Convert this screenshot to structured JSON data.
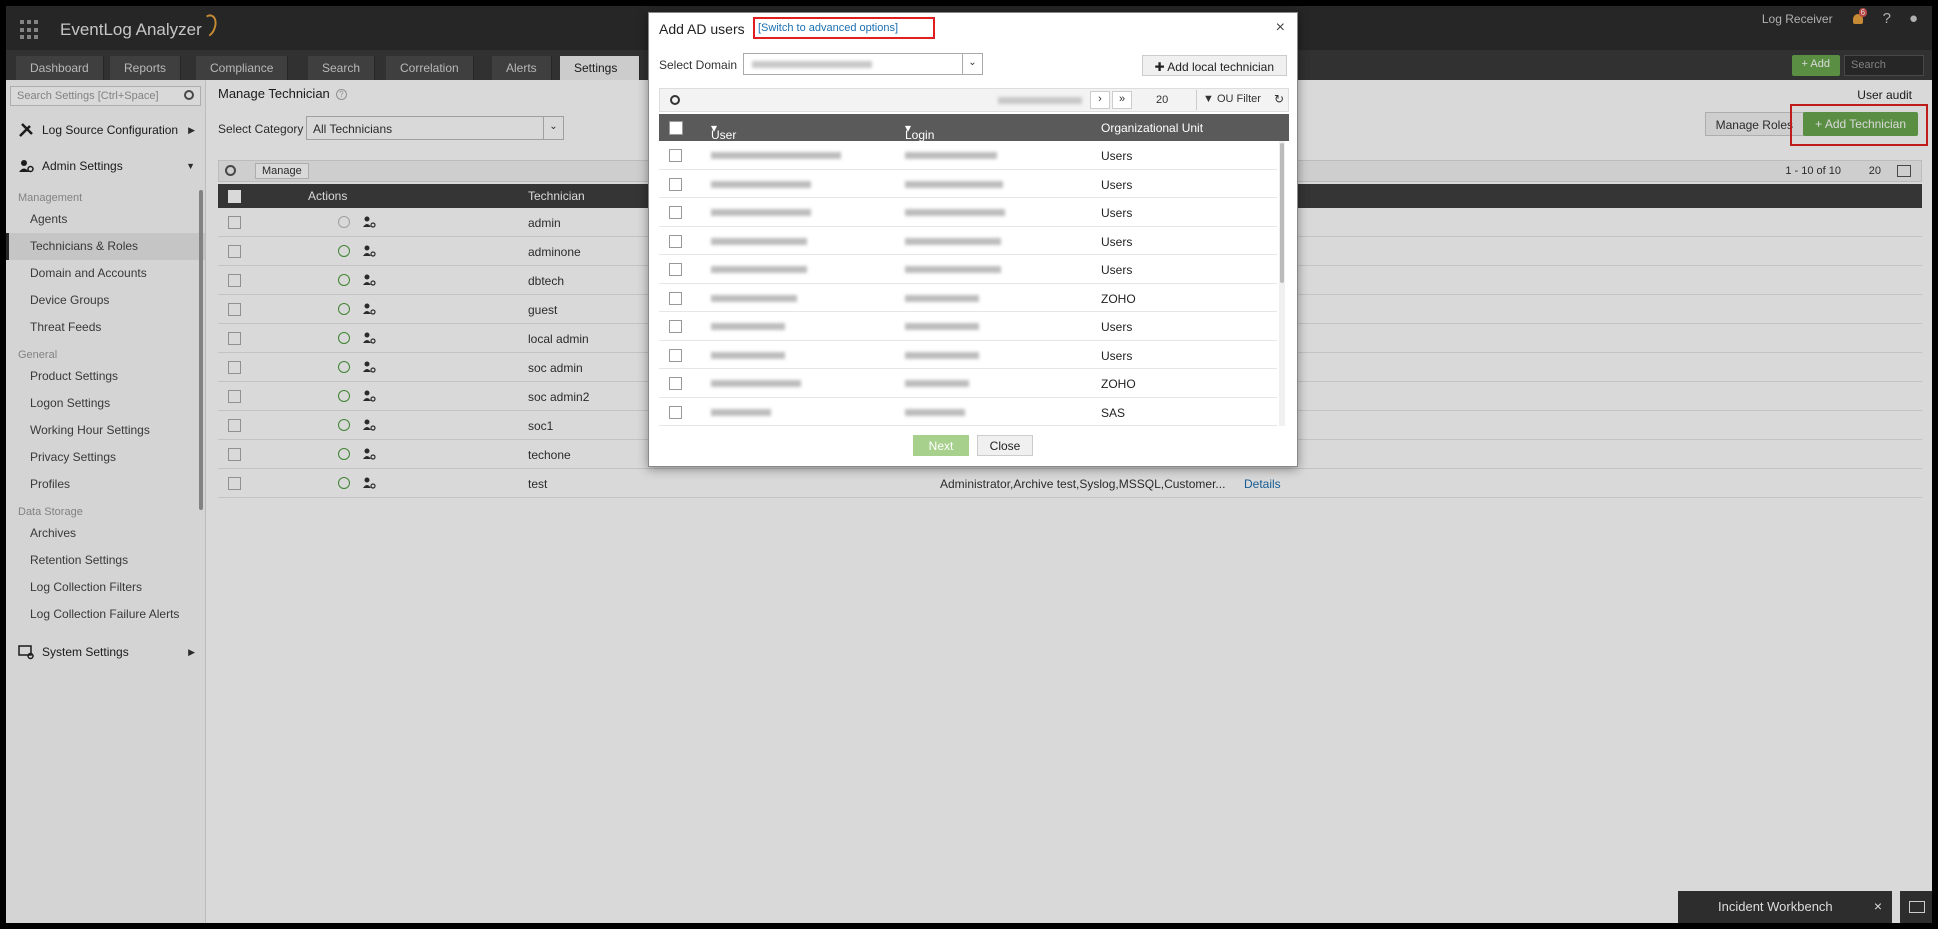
{
  "app": {
    "title": "EventLog Analyzer"
  },
  "header": {
    "log_receiver": "Log Receiver",
    "notif_count": "6",
    "help": "?",
    "user_icon": "user-circle-icon"
  },
  "nav": {
    "tabs": [
      "Dashboard",
      "Reports",
      "Compliance",
      "Search",
      "Correlation",
      "Alerts",
      "Settings"
    ],
    "active_tab": "Settings",
    "add_label": "+ Add",
    "search_placeholder": "Search"
  },
  "sidebar": {
    "search_placeholder": "Search Settings [Ctrl+Space]",
    "sections": {
      "log_source": "Log Source Configuration",
      "admin": "Admin Settings",
      "system": "System Settings"
    },
    "groups": [
      {
        "label": "Management",
        "items": [
          "Agents",
          "Technicians & Roles",
          "Domain and Accounts",
          "Device Groups",
          "Threat Feeds"
        ]
      },
      {
        "label": "General",
        "items": [
          "Product Settings",
          "Logon Settings",
          "Working Hour Settings",
          "Privacy Settings",
          "Profiles"
        ]
      },
      {
        "label": "Data Storage",
        "items": [
          "Archives",
          "Retention Settings",
          "Log Collection Filters",
          "Log Collection Failure Alerts"
        ]
      }
    ],
    "active_item": "Technicians & Roles"
  },
  "main": {
    "title": "Manage Technician",
    "user_audit": "User audit",
    "category_label": "Select Category",
    "category_value": "All Technicians",
    "manage_roles": "Manage Roles",
    "add_technician": "+ Add Technician",
    "manage": "Manage",
    "pager": "1 - 10 of 10",
    "per_page": "20",
    "columns": {
      "actions": "Actions",
      "technician": "Technician"
    },
    "technicians": [
      {
        "name": "admin"
      },
      {
        "name": "adminone"
      },
      {
        "name": "dbtech"
      },
      {
        "name": "guest"
      },
      {
        "name": "local admin"
      },
      {
        "name": "soc admin"
      },
      {
        "name": "soc admin2"
      },
      {
        "name": "soc1"
      },
      {
        "name": "techone"
      },
      {
        "name": "test",
        "roles": "Administrator,Archive test,Syslog,MSSQL,Customer...",
        "details": "Details"
      }
    ]
  },
  "modal": {
    "title": "Add AD users",
    "switch_link": "[Switch to advanced options]",
    "close_glyph": "×",
    "domain_label": "Select Domain",
    "add_local": "Add local technician",
    "per_page": "20",
    "ou_filter": "OU Filter",
    "columns": {
      "user": "User",
      "login": "Login name",
      "ou": "Organizational Unit"
    },
    "ous": [
      "Users",
      "Users",
      "Users",
      "Users",
      "Users",
      "ZOHO",
      "Users",
      "Users",
      "ZOHO",
      "SAS"
    ],
    "next": "Next",
    "close": "Close"
  },
  "workbench": {
    "label": "Incident Workbench"
  },
  "colors": {
    "accent_green": "#6aa84f",
    "highlight_red": "#e02020",
    "link_blue": "#1a6fb0"
  }
}
